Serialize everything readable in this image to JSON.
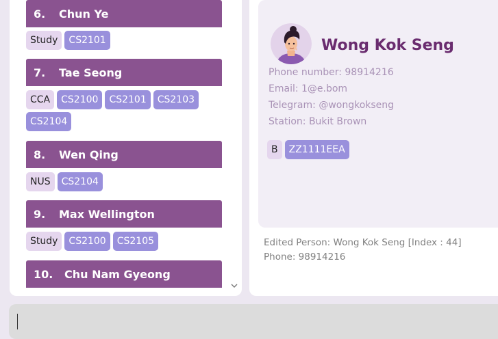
{
  "person_list": [
    {
      "index": "6.",
      "name": "Chun Ye",
      "tags": [
        {
          "label": "Study",
          "kind": "group"
        },
        {
          "label": "CS2101",
          "kind": "module"
        }
      ]
    },
    {
      "index": "7.",
      "name": "Tae Seong",
      "tags": [
        {
          "label": "CCA",
          "kind": "group"
        },
        {
          "label": "CS2100",
          "kind": "module"
        },
        {
          "label": "CS2101",
          "kind": "module"
        },
        {
          "label": "CS2103",
          "kind": "module"
        },
        {
          "label": "CS2104",
          "kind": "module"
        }
      ]
    },
    {
      "index": "8.",
      "name": "Wen Qing",
      "tags": [
        {
          "label": "NUS",
          "kind": "group"
        },
        {
          "label": "CS2104",
          "kind": "module"
        }
      ]
    },
    {
      "index": "9.",
      "name": "Max Wellington",
      "tags": [
        {
          "label": "Study",
          "kind": "group"
        },
        {
          "label": "CS2100",
          "kind": "module"
        },
        {
          "label": "CS2105",
          "kind": "module"
        }
      ]
    },
    {
      "index": "10.",
      "name": "Chu Nam Gyeong",
      "tags": []
    }
  ],
  "detail": {
    "name": "Wong Kok Seng",
    "phone": "Phone number: 98914216",
    "email": "Email: 1@e.bom",
    "telegram": "Telegram: @wongkokseng",
    "station": "Station: Bukit Brown",
    "tags": [
      {
        "label": "B",
        "kind": "group"
      },
      {
        "label": "ZZ1111EEA",
        "kind": "module"
      }
    ]
  },
  "result": {
    "line1": "Edited Person: Wong Kok Seng [Index : 44]",
    "line2": "Phone: 98914216"
  },
  "command": {
    "value": ""
  },
  "icons": {
    "scroll": "chevron-down-icon",
    "avatar": "avatar-illustration"
  },
  "colors": {
    "header": "#8a5390",
    "name": "#6a2c6f",
    "group_tag": "#e5d6ee",
    "module_tag": "#9990dc"
  }
}
